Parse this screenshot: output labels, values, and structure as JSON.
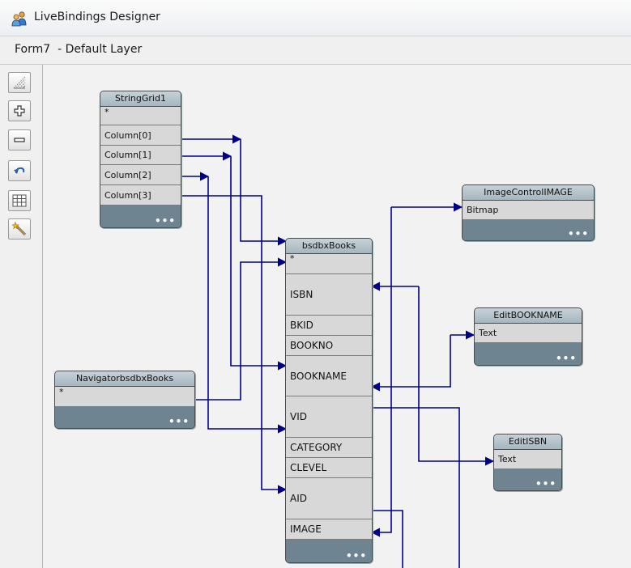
{
  "window": {
    "title": "LiveBindings Designer",
    "app_icon": "people-icon"
  },
  "subheader": {
    "title": "Form7  - Default Layer"
  },
  "toolbar": {
    "buttons": [
      {
        "name": "grid-icon"
      },
      {
        "name": "zoom-in-icon"
      },
      {
        "name": "zoom-out-icon"
      },
      {
        "name": "undo-icon"
      },
      {
        "name": "layout-icon"
      },
      {
        "name": "wizard-icon"
      }
    ]
  },
  "nodes": {
    "stringgrid": {
      "title": "StringGrid1",
      "rows": [
        "*",
        "Column[0]",
        "Column[1]",
        "Column[2]",
        "Column[3]"
      ],
      "more": "•••"
    },
    "books": {
      "title": "bsdbxBooks",
      "rows": [
        "*",
        "ISBN",
        "BKID",
        "BOOKNO",
        "BOOKNAME",
        "VID",
        "CATEGORY",
        "CLEVEL",
        "AID",
        "IMAGE"
      ],
      "more": "•••"
    },
    "navigator": {
      "title": "NavigatorbsdbxBooks",
      "rows": [
        "*"
      ],
      "more": "•••"
    },
    "imagecontrol": {
      "title": "ImageControlIMAGE",
      "rows": [
        "Bitmap"
      ],
      "more": "•••"
    },
    "editbookname": {
      "title": "EditBOOKNAME",
      "rows": [
        "Text"
      ],
      "more": "•••"
    },
    "editisbn": {
      "title": "EditISBN",
      "rows": [
        "Text"
      ],
      "more": "•••"
    }
  },
  "colors": {
    "wire": "#00008b",
    "node_footer": "#6e8490",
    "node_header": "#b4c3cb",
    "row": "#d8d8d8"
  }
}
